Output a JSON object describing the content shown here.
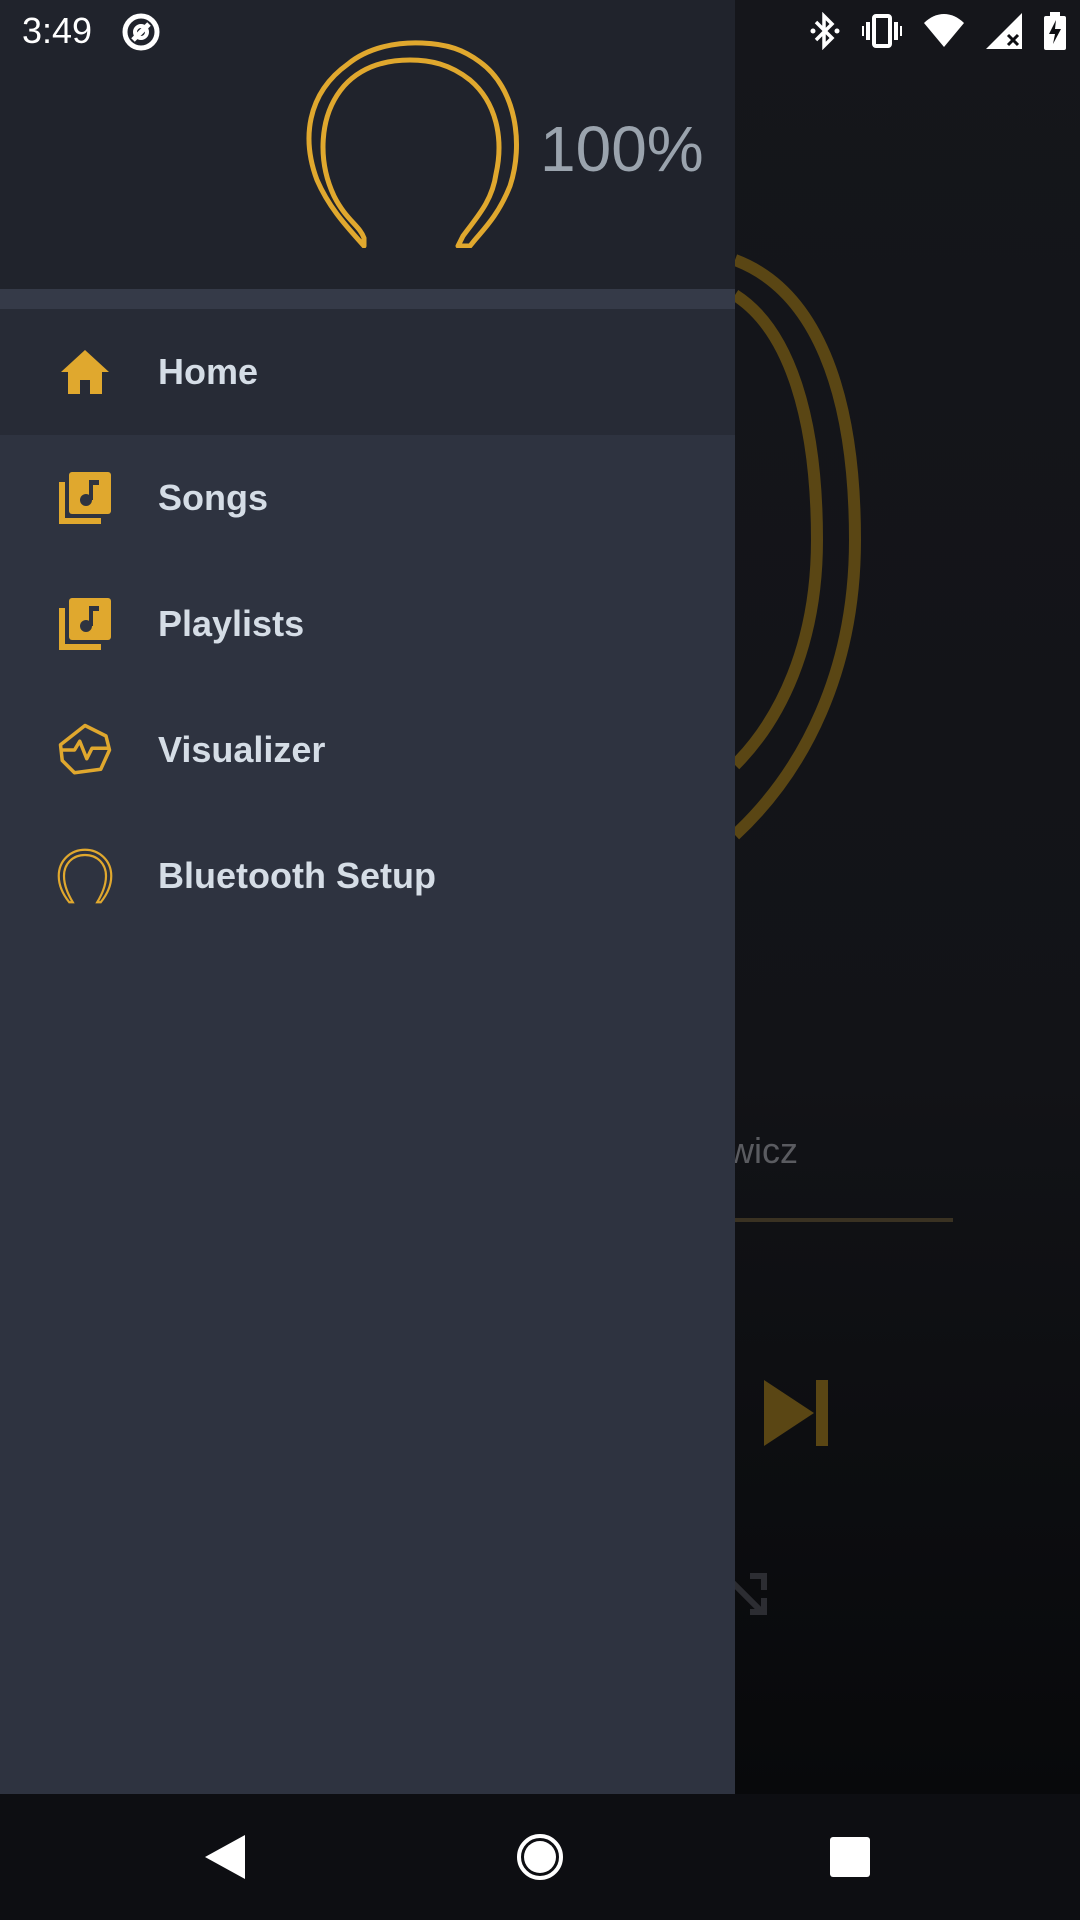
{
  "status_bar": {
    "time": "3:49",
    "icons": [
      "app-notification-icon",
      "bluetooth-icon",
      "vibrate-icon",
      "wifi-icon",
      "signal-icon",
      "battery-charging-icon"
    ]
  },
  "drawer": {
    "battery_percent": "100%",
    "accent_color": "#e0a82e",
    "items": [
      {
        "label": "Home",
        "icon": "home-icon",
        "active": true
      },
      {
        "label": "Songs",
        "icon": "music-library-icon",
        "active": false
      },
      {
        "label": "Playlists",
        "icon": "music-library-icon",
        "active": false
      },
      {
        "label": "Visualizer",
        "icon": "visualizer-icon",
        "active": false
      },
      {
        "label": "Bluetooth Setup",
        "icon": "headphone-icon",
        "active": false
      }
    ]
  },
  "background": {
    "artist_partial": "wicz"
  },
  "nav_bar": {
    "buttons": [
      "back-button",
      "home-button",
      "recents-button"
    ]
  }
}
